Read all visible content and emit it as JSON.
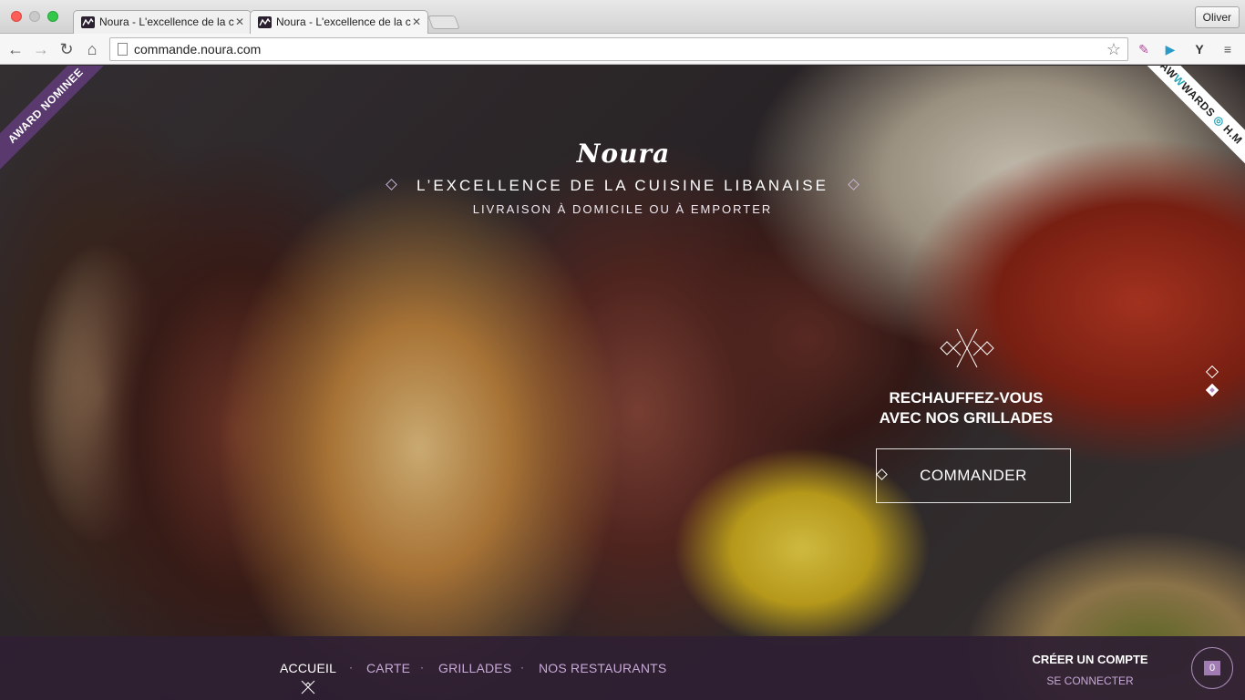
{
  "browser": {
    "tabs": [
      {
        "title": "Noura - L'excellence de la c"
      },
      {
        "title": "Noura - L'excellence de la c"
      }
    ],
    "profile": "Oliver",
    "url": "commande.noura.com",
    "icons": {
      "back": "back-arrow-icon",
      "forward": "forward-arrow-icon",
      "reload": "reload-icon",
      "home": "home-icon",
      "bookmark": "star-icon"
    }
  },
  "ribbons": {
    "left": "AWARD NOMINEE",
    "right_prefix": "AW",
    "right_accent": "W",
    "right_suffix": "WARDS",
    "right_tail": "H.M"
  },
  "brand": {
    "logo": "Noura",
    "tagline": "L’EXCELLENCE DE LA CUISINE LIBANAISE",
    "subtagline": "LIVRAISON À DOMICILE OU À EMPORTER"
  },
  "promo": {
    "title_line1": "RECHAUFFEZ-VOUS",
    "title_line2": "AVEC NOS GRILLADES",
    "cta": "COMMANDER"
  },
  "nav": {
    "items": [
      "ACCUEIL",
      "CARTE",
      "GRILLADES",
      "NOS RESTAURANTS"
    ],
    "active": "ACCUEIL",
    "separator": "·"
  },
  "account": {
    "create": "CRÉER UN COMPTE",
    "login": "SE CONNECTER"
  },
  "cart": {
    "count": "0"
  },
  "colors": {
    "brand_purple": "#2e1f33",
    "accent_lilac": "#c7a9d7",
    "ribbon_purple": "#5a3a6e"
  }
}
